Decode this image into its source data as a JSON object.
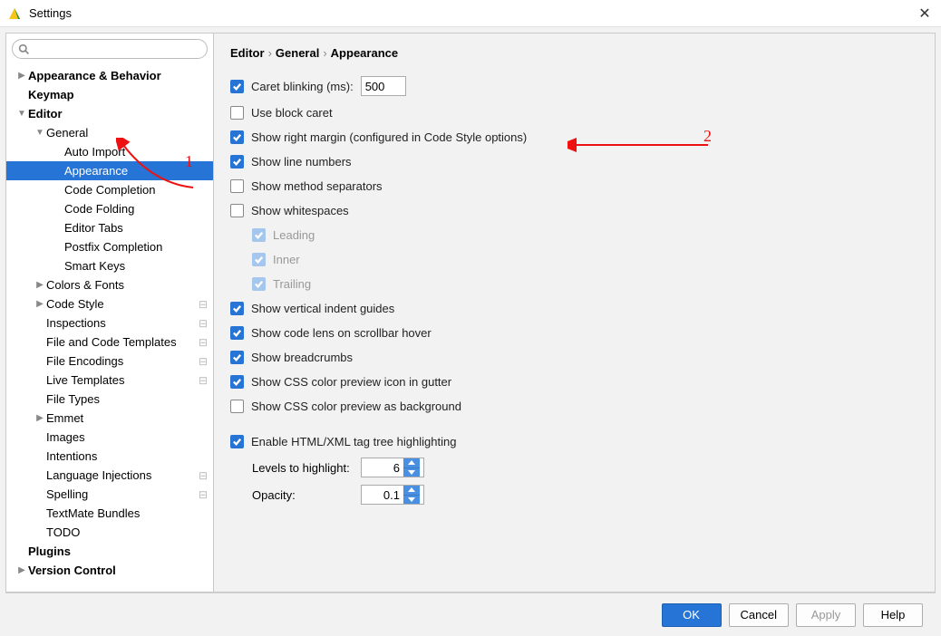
{
  "title": "Settings",
  "breadcrumb": [
    "Editor",
    "General",
    "Appearance"
  ],
  "tree": [
    {
      "d": 0,
      "label": "Appearance & Behavior",
      "bold": true,
      "arrow": "▶"
    },
    {
      "d": 0,
      "label": "Keymap",
      "bold": true,
      "arrow": ""
    },
    {
      "d": 0,
      "label": "Editor",
      "bold": true,
      "arrow": "▼"
    },
    {
      "d": 1,
      "label": "General",
      "arrow": "▼"
    },
    {
      "d": 2,
      "label": "Auto Import",
      "arrow": ""
    },
    {
      "d": 2,
      "label": "Appearance",
      "arrow": "",
      "selected": true
    },
    {
      "d": 2,
      "label": "Code Completion",
      "arrow": ""
    },
    {
      "d": 2,
      "label": "Code Folding",
      "arrow": ""
    },
    {
      "d": 2,
      "label": "Editor Tabs",
      "arrow": ""
    },
    {
      "d": 2,
      "label": "Postfix Completion",
      "arrow": ""
    },
    {
      "d": 2,
      "label": "Smart Keys",
      "arrow": ""
    },
    {
      "d": 1,
      "label": "Colors & Fonts",
      "arrow": "▶"
    },
    {
      "d": 1,
      "label": "Code Style",
      "arrow": "▶",
      "tag": true
    },
    {
      "d": 1,
      "label": "Inspections",
      "arrow": "",
      "tag": true
    },
    {
      "d": 1,
      "label": "File and Code Templates",
      "arrow": "",
      "tag": true
    },
    {
      "d": 1,
      "label": "File Encodings",
      "arrow": "",
      "tag": true
    },
    {
      "d": 1,
      "label": "Live Templates",
      "arrow": "",
      "tag": true
    },
    {
      "d": 1,
      "label": "File Types",
      "arrow": ""
    },
    {
      "d": 1,
      "label": "Emmet",
      "arrow": "▶"
    },
    {
      "d": 1,
      "label": "Images",
      "arrow": ""
    },
    {
      "d": 1,
      "label": "Intentions",
      "arrow": ""
    },
    {
      "d": 1,
      "label": "Language Injections",
      "arrow": "",
      "tag": true
    },
    {
      "d": 1,
      "label": "Spelling",
      "arrow": "",
      "tag": true
    },
    {
      "d": 1,
      "label": "TextMate Bundles",
      "arrow": ""
    },
    {
      "d": 1,
      "label": "TODO",
      "arrow": ""
    },
    {
      "d": 0,
      "label": "Plugins",
      "bold": true,
      "arrow": ""
    },
    {
      "d": 0,
      "label": "Version Control",
      "bold": true,
      "arrow": "▶"
    }
  ],
  "opts": {
    "caret_blinking": "Caret blinking (ms):",
    "caret_ms": "500",
    "use_block_caret": "Use block caret",
    "show_right_margin": "Show right margin (configured in Code Style options)",
    "show_line_numbers": "Show line numbers",
    "show_method_sep": "Show method separators",
    "show_whitespaces": "Show whitespaces",
    "leading": "Leading",
    "inner": "Inner",
    "trailing": "Trailing",
    "vertical_indent": "Show vertical indent guides",
    "code_lens": "Show code lens on scrollbar hover",
    "breadcrumbs": "Show breadcrumbs",
    "css_preview_gutter": "Show CSS color preview icon in gutter",
    "css_preview_bg": "Show CSS color preview as background",
    "html_xml": "Enable HTML/XML tag tree highlighting",
    "levels_label": "Levels to highlight:",
    "levels_val": "6",
    "opacity_label": "Opacity:",
    "opacity_val": "0.1"
  },
  "buttons": {
    "ok": "OK",
    "cancel": "Cancel",
    "apply": "Apply",
    "help": "Help"
  },
  "annot": {
    "n1": "1",
    "n2": "2"
  }
}
